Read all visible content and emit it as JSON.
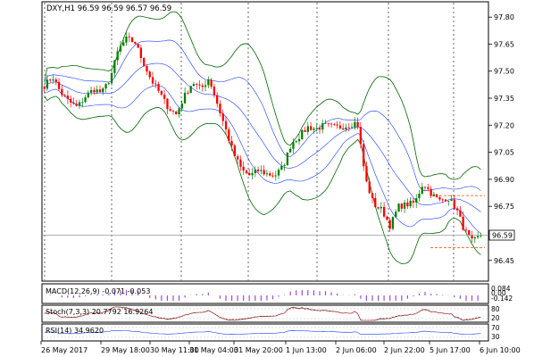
{
  "chart_data": {
    "type": "candlestick",
    "title": "DXY,H1",
    "ohlc_header": "96.59 96.59 96.57 96.59",
    "last_price": "96.59",
    "y_ticks": [
      "97.80",
      "97.65",
      "97.50",
      "97.35",
      "97.20",
      "97.05",
      "96.90",
      "96.75",
      "96.60",
      "96.45"
    ],
    "ylim": [
      96.34,
      97.88
    ],
    "x_labels": [
      "26 May 2017",
      "29 May 18:00",
      "30 May 11:00",
      "31 May 04:00",
      "31 May 20:00",
      "1 Jun 13:00",
      "2 Jun 06:00",
      "2 Jun 22:00",
      "5 Jun 17:00",
      "6 Jun 10:00"
    ],
    "grid": "vertical-dotted",
    "bull_color": "#008000",
    "bear_color": "#ff0000",
    "band_outer_color": "#006400",
    "band_inner_color": "#1c3cff",
    "price_path": [
      97.42,
      97.47,
      97.38,
      97.33,
      97.3,
      97.36,
      97.4,
      97.38,
      97.46,
      97.62,
      97.68,
      97.66,
      97.55,
      97.45,
      97.38,
      97.3,
      97.26,
      97.36,
      97.44,
      97.4,
      97.46,
      97.32,
      97.18,
      97.04,
      96.95,
      96.92,
      96.95,
      96.93,
      96.92,
      96.97,
      97.1,
      97.14,
      97.19,
      97.18,
      97.2,
      97.19,
      97.19,
      97.2,
      97.22,
      96.9,
      96.76,
      96.73,
      96.64,
      96.75,
      96.76,
      96.77,
      96.88,
      96.82,
      96.78,
      96.8,
      96.74,
      96.62,
      96.55,
      96.59
    ],
    "signal_levels": [
      96.81,
      96.52
    ],
    "indicators": [
      {
        "label": "MACD(12,26,9) -0.071 -0.053",
        "ticks": [
          "0.084",
          "0.00",
          "-0.142"
        ]
      },
      {
        "label": "Stoch(7,3,3) 20.7792 16.9264",
        "ticks": [
          "80",
          "20"
        ]
      },
      {
        "label": "RSI(14) 34.9620",
        "ticks": [
          "70",
          "30"
        ]
      }
    ]
  }
}
